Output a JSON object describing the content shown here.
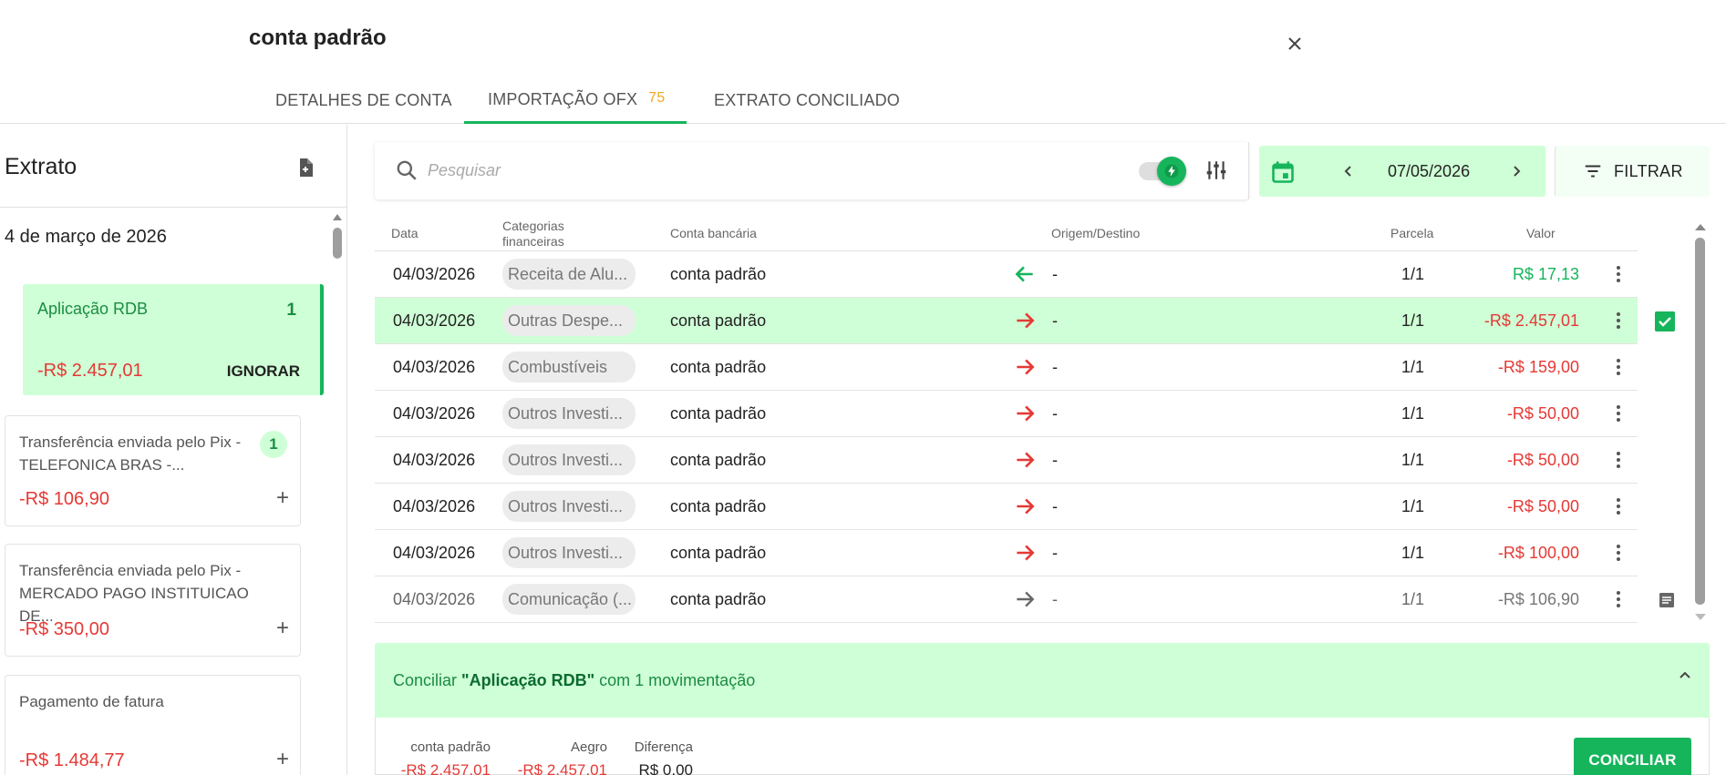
{
  "modal": {
    "title": "conta padrão"
  },
  "tabs": [
    {
      "label": "DETALHES DE CONTA"
    },
    {
      "label": "IMPORTAÇÃO OFX",
      "badge": "75"
    },
    {
      "label": "EXTRATO CONCILIADO"
    }
  ],
  "left": {
    "title": "Extrato",
    "date_header": "4 de março de 2026",
    "active_card": {
      "title": "Aplicação RDB",
      "count": "1",
      "value": "-R$ 2.457,01",
      "ignore_label": "IGNORAR"
    },
    "cards": [
      {
        "title": "Transferência enviada pelo Pix - TELEFONICA BRAS -...",
        "count": "1",
        "value": "-R$ 106,90"
      },
      {
        "title": "Transferência enviada pelo Pix - MERCADO PAGO INSTITUICAO DE...",
        "value": "-R$ 350,00"
      },
      {
        "title": "Pagamento de fatura",
        "value": "-R$ 1.484,77"
      }
    ]
  },
  "toolbar": {
    "search_placeholder": "Pesquisar",
    "date": "07/05/2026",
    "filter_label": "FILTRAR"
  },
  "table": {
    "headers": {
      "date": "Data",
      "category_line1": "Categorias",
      "category_line2": "financeiras",
      "account": "Conta bancária",
      "origin": "Origem/Destino",
      "installment": "Parcela",
      "value": "Valor"
    },
    "rows": [
      {
        "date": "04/03/2026",
        "category": "Receita de Alu...",
        "account": "conta padrão",
        "direction": "in",
        "origin": "-",
        "installment": "1/1",
        "value": "R$ 17,13",
        "tone": "pos"
      },
      {
        "date": "04/03/2026",
        "category": "Outras Despe...",
        "account": "conta padrão",
        "direction": "out",
        "origin": "-",
        "installment": "1/1",
        "value": "-R$ 2.457,01",
        "tone": "neg",
        "selected": true
      },
      {
        "date": "04/03/2026",
        "category": "Combustíveis",
        "account": "conta padrão",
        "direction": "out",
        "origin": "-",
        "installment": "1/1",
        "value": "-R$ 159,00",
        "tone": "neg"
      },
      {
        "date": "04/03/2026",
        "category": "Outros Investi...",
        "account": "conta padrão",
        "direction": "out",
        "origin": "-",
        "installment": "1/1",
        "value": "-R$ 50,00",
        "tone": "neg"
      },
      {
        "date": "04/03/2026",
        "category": "Outros Investi...",
        "account": "conta padrão",
        "direction": "out",
        "origin": "-",
        "installment": "1/1",
        "value": "-R$ 50,00",
        "tone": "neg"
      },
      {
        "date": "04/03/2026",
        "category": "Outros Investi...",
        "account": "conta padrão",
        "direction": "out",
        "origin": "-",
        "installment": "1/1",
        "value": "-R$ 50,00",
        "tone": "neg"
      },
      {
        "date": "04/03/2026",
        "category": "Outros Investi...",
        "account": "conta padrão",
        "direction": "out",
        "origin": "-",
        "installment": "1/1",
        "value": "-R$ 100,00",
        "tone": "neg"
      },
      {
        "date": "04/03/2026",
        "category": "Comunicação (...",
        "account": "conta padrão",
        "direction": "neutral",
        "origin": "-",
        "installment": "1/1",
        "value": "-R$ 106,90",
        "tone": "gray",
        "muted": true
      }
    ]
  },
  "reconcile": {
    "prefix": "Conciliar ",
    "item": "\"Aplicação RDB\"",
    "suffix": " com 1 movimentação",
    "summary": [
      {
        "label": "conta padrão",
        "value": "-R$ 2.457,01",
        "tone": "neg"
      },
      {
        "label": "Aegro",
        "value": "-R$ 2.457,01",
        "tone": "neg"
      },
      {
        "label": "Diferença",
        "value": "R$ 0,00",
        "tone": "neutral"
      }
    ],
    "button_label": "CONCILIAR"
  },
  "colors": {
    "accent": "#16b55c",
    "accent_light": "#cfffd6",
    "negative": "#e53935",
    "badge": "#f5a623"
  }
}
